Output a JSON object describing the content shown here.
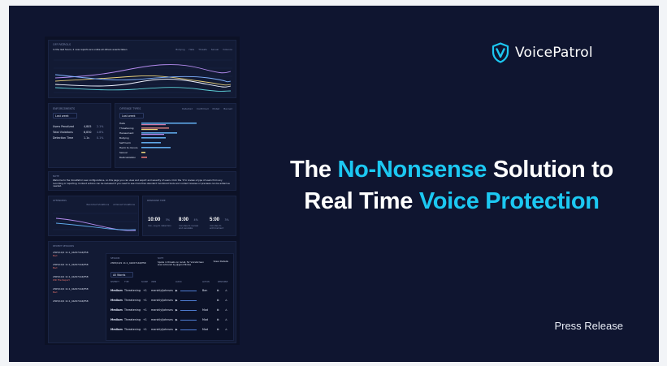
{
  "brand": {
    "name": "VoicePatrol",
    "accent": "#1cc8f2",
    "background": "#0f1530",
    "logo_icon": "shield-v-icon"
  },
  "headline": {
    "line1_before": "The ",
    "line1_highlight": "No-Nonsense",
    "line1_after": " Solution to",
    "line2_before": "Real Time ",
    "line2_highlight": "Voice Protection"
  },
  "footer": {
    "press_label": "Press Release"
  },
  "dashboard": {
    "trend": {
      "title": "OFF PATROLS",
      "subtitle": "In the last hours, 2 new reports are unlike all others events taken",
      "legend": [
        "Bullying",
        "Hate",
        "Threats",
        "Sexual",
        "Violence"
      ],
      "series_colors": [
        "#b58cf0",
        "#e8d07a",
        "#7fb2ff",
        "#f0f4ff",
        "#5ed1d8"
      ]
    },
    "rates": {
      "title": "ENFORCEMENTS",
      "select": "Last week",
      "rows": [
        {
          "label": "Users Penalized",
          "value": "4,805",
          "delta": "2.1%"
        },
        {
          "label": "Total Violations",
          "value": "6,830",
          "delta": "4.8%"
        },
        {
          "label": "Detection Time",
          "value": "1.1s",
          "delta": "0.1%"
        }
      ]
    },
    "categories": {
      "title": "OFFENSE TYPES",
      "select": "Last week",
      "legend": [
        "Detected",
        "Confirmed",
        "Muted",
        "Banned"
      ],
      "labels": [
        "Hate",
        "Threatening",
        "Harassment",
        "Bullying",
        "Self harm",
        "Harm to minors",
        "Sexual",
        "Radicalization"
      ]
    },
    "notes": {
      "title": "NOTE",
      "text": "Welcome to the VoicePatrol new configurations, on this page you can view and export and severity of users. Click the 'ℹ' to review a type of users from any recording or reporting. Content actions can be reviewed if you need to see more than standard monitored tools and content reviews or previews can be added as needed."
    },
    "violators": {
      "title": "OFFENDERS",
      "legend": [
        "Recorded Violations",
        "Actioned Violations"
      ]
    },
    "times": {
      "title": "RESPONSE TIME",
      "items": [
        {
          "value": "10:00",
          "label": "min, avg to detection",
          "delta": "5%"
        },
        {
          "value": "8:00",
          "label": "minutes to review and escalate",
          "delta": "4%"
        },
        {
          "value": "5:00",
          "label": "minutes to enforcement",
          "delta": "3%"
        }
      ]
    },
    "sessions": {
      "title": "RECENT SESSIONS",
      "ids": [
        "2305/10/1 11:1_44A57144/E58",
        "2305/10/1 11:1_44A57144/E58",
        "2305/10/1 11:1_44A57144/E58",
        "2305/10/1 11:1_44A57144/E58",
        "2305/10/1 11:1_44A57144/E58"
      ],
      "tags": [
        "Bad",
        "Bad",
        "Will File Report",
        "Bad",
        ""
      ]
    },
    "detail": {
      "session_label": "SESSION",
      "session_id": "2305/10/1 11:1_44A57144/E58",
      "note_label": "NOTE",
      "note_text": "Spoke in threats on recall, for VoiceScreen was removed by @good Notes",
      "view_details": "View Details",
      "filter": "All Words",
      "columns": [
        "SEVERITY",
        "TYPE",
        "SCORE",
        "USER",
        "AUDIO",
        "ACTION",
        "RESPONSE"
      ],
      "rows": [
        {
          "severity": "Medium",
          "type": "Threatening",
          "score": "+1",
          "user": "marshlyljohnsns",
          "action": "Ban"
        },
        {
          "severity": "Medium",
          "type": "Threatening",
          "score": "+1",
          "user": "marshlyljohnsns",
          "action": ""
        },
        {
          "severity": "Medium",
          "type": "Threatening",
          "score": "+1",
          "user": "marshlyljohnsns",
          "action": "Mod"
        },
        {
          "severity": "Medium",
          "type": "Threatening",
          "score": "+1",
          "user": "marshlyljohnsns",
          "action": "Mod"
        },
        {
          "severity": "Medium",
          "type": "Threatening",
          "score": "+1",
          "user": "marshlyljohnsns",
          "action": "Mod"
        }
      ]
    }
  }
}
